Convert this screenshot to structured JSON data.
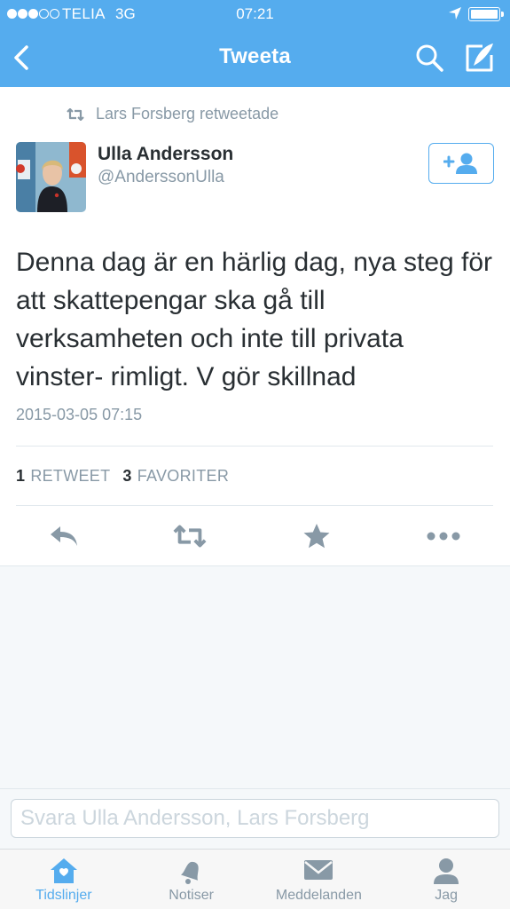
{
  "status_bar": {
    "carrier": "TELIA",
    "network": "3G",
    "time": "07:21",
    "signal_bars_filled": 3,
    "signal_bars_total": 5
  },
  "nav": {
    "title": "Tweeta",
    "back_icon": "chevron-left-icon",
    "search_icon": "search-icon",
    "compose_icon": "compose-icon"
  },
  "tweet": {
    "retweeted_by": "Lars Forsberg retweetade",
    "author_name": "Ulla Andersson",
    "author_handle": "@AnderssonUlla",
    "text": "Denna dag är en härlig dag, nya steg för att skattepengar ska gå till verksamheten och inte till privata vinster- rimligt. V gör skillnad",
    "timestamp": "2015-03-05 07:15",
    "retweet_count": "1",
    "retweet_label": "RETWEET",
    "favorite_count": "3",
    "favorite_label": "FAVORITER"
  },
  "reply": {
    "placeholder": "Svara Ulla Andersson, Lars Forsberg"
  },
  "tabs": [
    {
      "label": "Tidslinjer",
      "icon": "home-icon",
      "active": true
    },
    {
      "label": "Notiser",
      "icon": "bell-icon",
      "active": false
    },
    {
      "label": "Meddelanden",
      "icon": "envelope-icon",
      "active": false
    },
    {
      "label": "Jag",
      "icon": "person-icon",
      "active": false
    }
  ],
  "colors": {
    "brand": "#55acee",
    "muted": "#8899a6",
    "text": "#292f33"
  }
}
